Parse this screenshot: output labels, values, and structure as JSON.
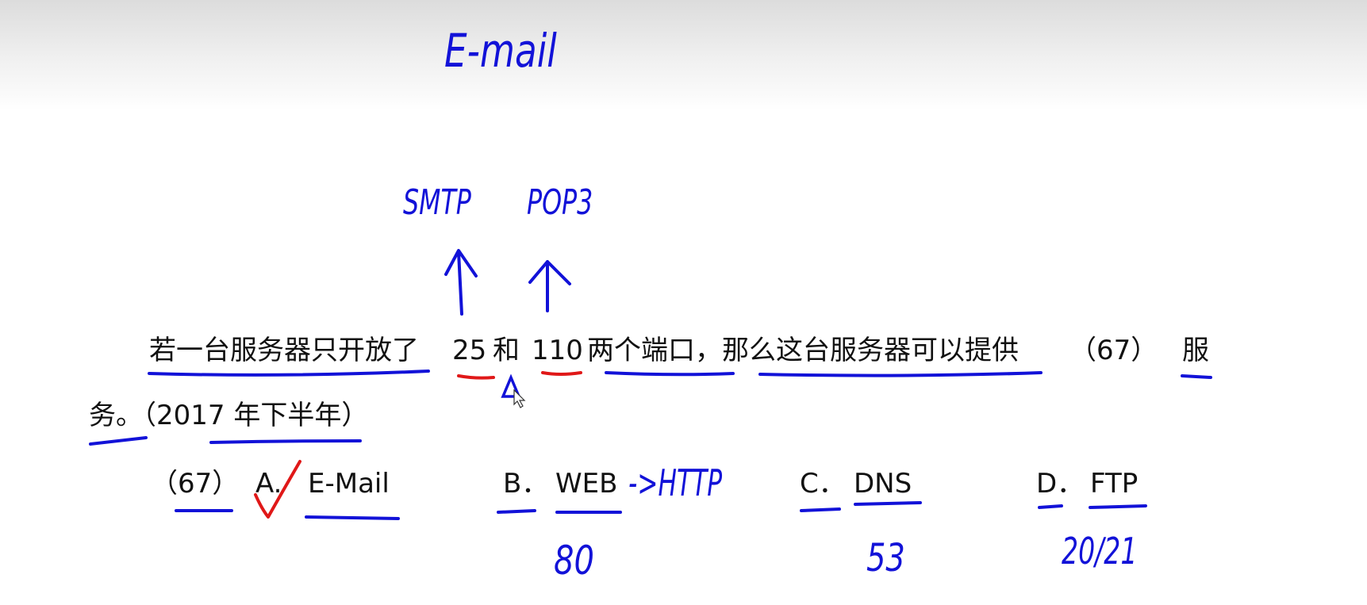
{
  "question": {
    "part1": "若一台服务器只开放了",
    "port_a": "25",
    "and": "和",
    "port_b": "110",
    "part2": "两个端口，那么这台服务器可以提供",
    "blank": "（67）",
    "part3": "服",
    "part4": "务。（2017 年下半年）"
  },
  "options": {
    "number": "（67）",
    "a_letter": "A.",
    "a_text": "E-Mail",
    "b_letter": "B．",
    "b_text": "WEB",
    "c_letter": "C．",
    "c_text": "DNS",
    "d_letter": "D．",
    "d_text": "FTP"
  },
  "handwriting": {
    "email": "E-mail",
    "smtp": "SMTP",
    "pop3": "POP3",
    "http_arrow": "->HTTP",
    "port_80": "80",
    "port_53": "53",
    "port_ftp": "20/21"
  },
  "colors": {
    "ink_blue": "#1212d8",
    "ink_red": "#e01818"
  }
}
